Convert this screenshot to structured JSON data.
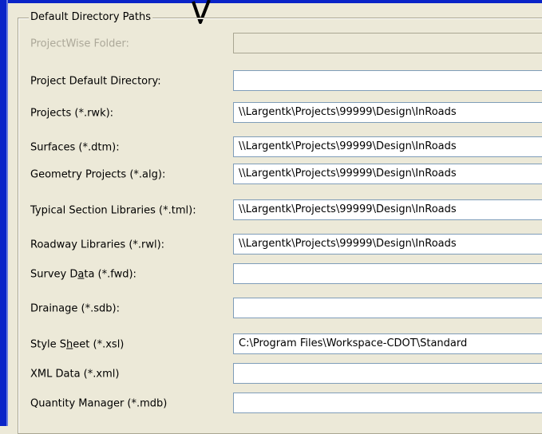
{
  "group": {
    "title": "Default Directory Paths"
  },
  "rows": [
    {
      "label": "ProjectWise Folder:",
      "value": "",
      "disabled": true
    },
    {
      "label": "Project Default Directory:",
      "value": ""
    },
    {
      "label": "Projects (*.rwk):",
      "value": "\\\\Largentk\\Projects\\99999\\Design\\InRoads"
    },
    {
      "label": "Surfaces (*.dtm):",
      "value": "\\\\Largentk\\Projects\\99999\\Design\\InRoads"
    },
    {
      "label": "Geometry Projects (*.alg):",
      "value": "\\\\Largentk\\Projects\\99999\\Design\\InRoads"
    },
    {
      "label": "Typical Section Libraries (*.tml):",
      "value": "\\\\Largentk\\Projects\\99999\\Design\\InRoads"
    },
    {
      "label": "Roadway Libraries (*.rwl):",
      "value": "\\\\Largentk\\Projects\\99999\\Design\\InRoads"
    },
    {
      "label_pre": "Survey D",
      "label_u": "a",
      "label_post": "ta (*.fwd):",
      "value": ""
    },
    {
      "label": "Drainage (*.sdb):",
      "value": ""
    },
    {
      "label_pre": "Style S",
      "label_u": "h",
      "label_post": "eet (*.xsl)",
      "value": "C:\\Program Files\\Workspace-CDOT\\Standard"
    },
    {
      "label": "XML Data (*.xml)",
      "value": ""
    },
    {
      "label": "Quantity Manager (*.mdb)",
      "value": ""
    }
  ]
}
